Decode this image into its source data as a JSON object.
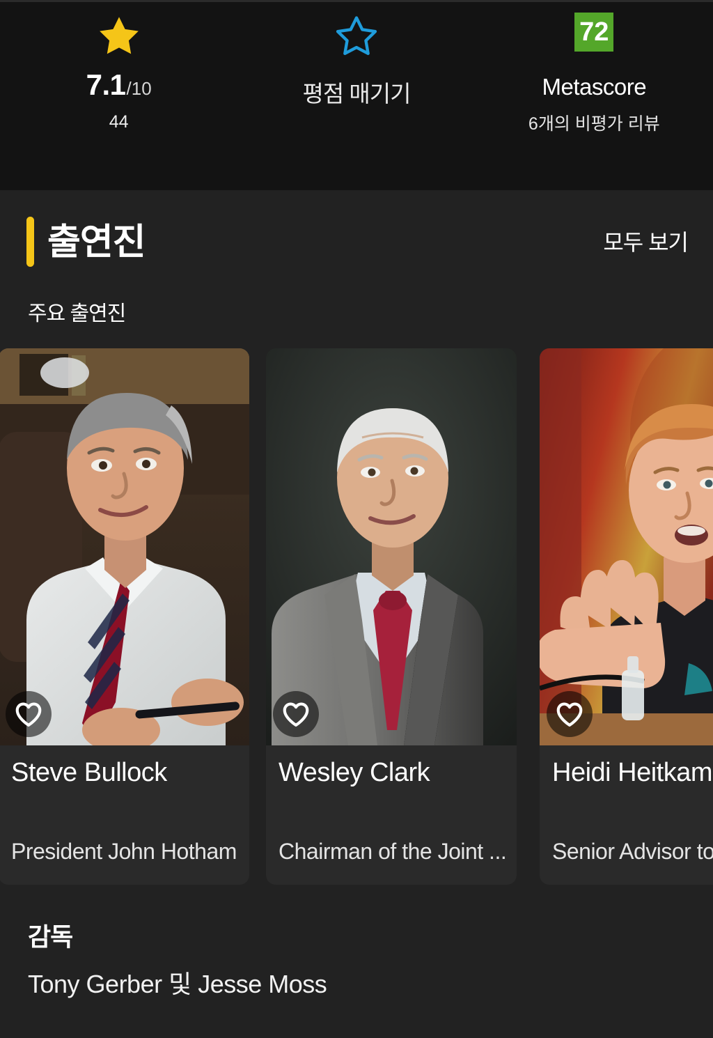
{
  "ratings": {
    "user_rating": {
      "icon": "star-filled-icon",
      "icon_color": "#F5C518",
      "score": "7.1",
      "denominator": "/10",
      "vote_count": "44"
    },
    "rate_action": {
      "icon": "star-outline-icon",
      "icon_color": "#1f9cdb",
      "label": "평점 매기기"
    },
    "metascore": {
      "value": "72",
      "badge_color": "#54A72A",
      "label": "Metascore",
      "sublabel": "6개의 비평가 리뷰"
    }
  },
  "cast_section": {
    "title": "출연진",
    "accent_color": "#F5C518",
    "see_all_label": "모두 보기",
    "subsection_label": "주요 출연진",
    "cards": [
      {
        "name": "Steve Bullock",
        "role": "President John Hotham",
        "favorite_icon": "heart-outline-icon"
      },
      {
        "name": "Wesley Clark",
        "role": "Chairman of the Joint ...",
        "favorite_icon": "heart-outline-icon"
      },
      {
        "name": "Heidi Heitkamp",
        "role": "Senior Advisor to",
        "favorite_icon": "heart-outline-icon"
      }
    ]
  },
  "director": {
    "label": "감독",
    "names": "Tony Gerber 및 Jesse Moss"
  }
}
